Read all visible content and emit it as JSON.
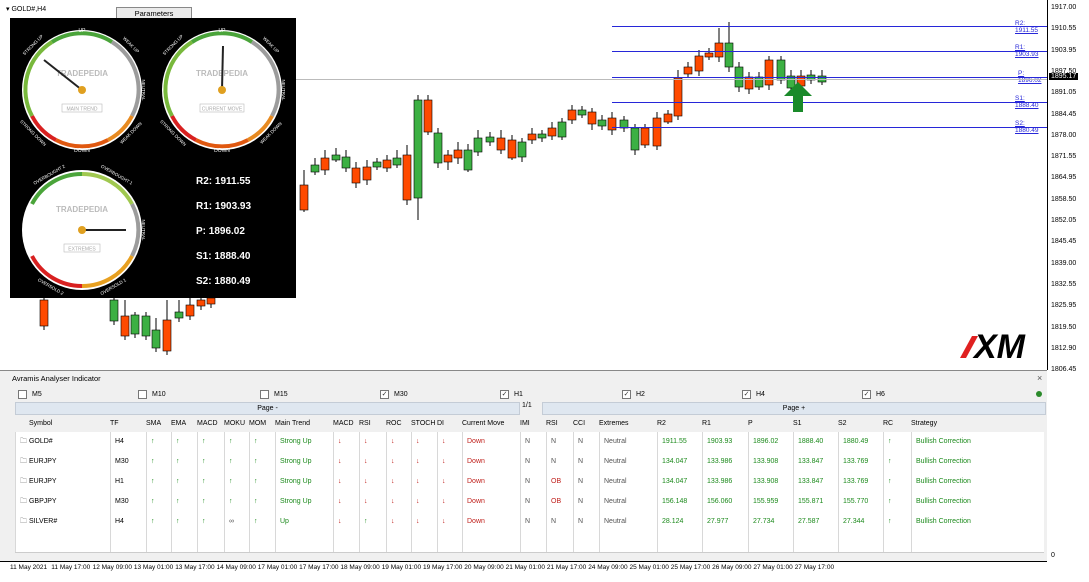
{
  "symbol_label": "GOLD#,H4",
  "params_button": "Parameters",
  "gauges": [
    {
      "brand": "TRADEPEDIA",
      "caption": "MAIN TREND",
      "labels": {
        "up": "UP",
        "strong_up": "STRONG UP",
        "weak_up": "WEAK UP",
        "neutral": "NEUTRAL",
        "strong_down": "STRONG DOWN",
        "weak_down": "WEAK DOWN",
        "down": "DOWN"
      }
    },
    {
      "brand": "TRADEPEDIA",
      "caption": "CURRENT MOVE",
      "labels": {
        "up": "UP",
        "strong_up": "STRONG UP",
        "weak_up": "WEAK UP",
        "neutral": "NEUTRAL",
        "strong_down": "STRONG DOWN",
        "weak_down": "WEAK DOWN",
        "down": "DOWN"
      }
    },
    {
      "brand": "TRADEPEDIA",
      "caption": "EXTREMES",
      "labels": {
        "ob2": "OVERBOUGHT 2",
        "ob1": "OVERBOUGHT 1",
        "neutral": "NEUTRAL",
        "os2": "OVERSOLD 2",
        "os1": "OVERSOLD 1"
      }
    }
  ],
  "pivots_panel": {
    "r2": "R2: 1911.55",
    "r1": "R1: 1903.93",
    "p": "P:   1896.02",
    "s1": "S1: 1888.40",
    "s2": "S2: 1880.49"
  },
  "pivot_lines": {
    "r2": "R2: 1911.55",
    "r1": "R1: 1903.93",
    "p": "P: 1896.02",
    "s1": "S1: 1888.40",
    "s2": "S2: 1880.49"
  },
  "price_axis": [
    "1917.00",
    "1910.55",
    "1903.95",
    "1897.50",
    "1891.05",
    "1884.45",
    "1878.00",
    "1871.55",
    "1864.95",
    "1858.50",
    "1852.05",
    "1845.45",
    "1839.00",
    "1832.55",
    "1825.95",
    "1819.50",
    "1812.90",
    "1806.45"
  ],
  "current_price": "1895.17",
  "logo_text": "XM",
  "panel": {
    "title": "Avramis Analyser Indicator",
    "close": "×",
    "timeframes": [
      {
        "label": "M5",
        "checked": false
      },
      {
        "label": "M10",
        "checked": false
      },
      {
        "label": "M15",
        "checked": false
      },
      {
        "label": "M30",
        "checked": true
      },
      {
        "label": "H1",
        "checked": true
      },
      {
        "label": "H2",
        "checked": true
      },
      {
        "label": "H4",
        "checked": true
      },
      {
        "label": "H6",
        "checked": true
      }
    ],
    "page_prev": "Page -",
    "page_next": "Page +",
    "page_num": "1/1",
    "headers": [
      "Symbol",
      "TF",
      "SMA",
      "EMA",
      "MACD",
      "MOKU",
      "MOM",
      "Main Trend",
      "MACD",
      "RSI",
      "ROC",
      "STOCH",
      "DI",
      "Current Move",
      "IMI",
      "RSI",
      "CCI",
      "Extremes",
      "R2",
      "R1",
      "P",
      "S1",
      "S2",
      "RC",
      "Strategy"
    ],
    "rows": [
      {
        "symbol": "GOLD#",
        "tf": "H4",
        "sma": "↑",
        "ema": "↑",
        "macd": "↑",
        "moku": "↑",
        "mom": "↑",
        "main_trend": "Strong Up",
        "macd2": "↓",
        "rsi": "↓",
        "roc": "↓",
        "stoch": "↓",
        "di": "↓",
        "current_move": "Down",
        "imi": "N",
        "rsi2": "N",
        "cci": "N",
        "extremes": "Neutral",
        "r2": "1911.55",
        "r1": "1903.93",
        "p": "1896.02",
        "s1": "1888.40",
        "s2": "1880.49",
        "rc": "↑",
        "strategy": "Bullish Correction"
      },
      {
        "symbol": "EURJPY",
        "tf": "M30",
        "sma": "↑",
        "ema": "↑",
        "macd": "↑",
        "moku": "↑",
        "mom": "↑",
        "main_trend": "Strong Up",
        "macd2": "↓",
        "rsi": "↓",
        "roc": "↓",
        "stoch": "↓",
        "di": "↓",
        "current_move": "Down",
        "imi": "N",
        "rsi2": "N",
        "cci": "N",
        "extremes": "Neutral",
        "r2": "134.047",
        "r1": "133.986",
        "p": "133.908",
        "s1": "133.847",
        "s2": "133.769",
        "rc": "↑",
        "strategy": "Bullish Correction"
      },
      {
        "symbol": "EURJPY",
        "tf": "H1",
        "sma": "↑",
        "ema": "↑",
        "macd": "↑",
        "moku": "↑",
        "mom": "↑",
        "main_trend": "Strong Up",
        "macd2": "↓",
        "rsi": "↓",
        "roc": "↓",
        "stoch": "↓",
        "di": "↓",
        "current_move": "Down",
        "imi": "N",
        "rsi2": "OB",
        "cci": "N",
        "extremes": "Neutral",
        "r2": "134.047",
        "r1": "133.986",
        "p": "133.908",
        "s1": "133.847",
        "s2": "133.769",
        "rc": "↑",
        "strategy": "Bullish Correction"
      },
      {
        "symbol": "GBPJPY",
        "tf": "M30",
        "sma": "↑",
        "ema": "↑",
        "macd": "↑",
        "moku": "↑",
        "mom": "↑",
        "main_trend": "Strong Up",
        "macd2": "↓",
        "rsi": "↓",
        "roc": "↓",
        "stoch": "↓",
        "di": "↓",
        "current_move": "Down",
        "imi": "N",
        "rsi2": "OB",
        "cci": "N",
        "extremes": "Neutral",
        "r2": "156.148",
        "r1": "156.060",
        "p": "155.959",
        "s1": "155.871",
        "s2": "155.770",
        "rc": "↑",
        "strategy": "Bullish Correction"
      },
      {
        "symbol": "SILVER#",
        "tf": "H4",
        "sma": "↑",
        "ema": "↑",
        "macd": "↑",
        "moku": "∞",
        "mom": "↑",
        "main_trend": "Up",
        "macd2": "↓",
        "rsi": "↑",
        "roc": "↓",
        "stoch": "↓",
        "di": "↓",
        "current_move": "Down",
        "imi": "N",
        "rsi2": "N",
        "cci": "N",
        "extremes": "Neutral",
        "r2": "28.124",
        "r1": "27.977",
        "p": "27.734",
        "s1": "27.587",
        "s2": "27.344",
        "rc": "↑",
        "strategy": "Bullish Correction"
      }
    ],
    "zero_label": "0"
  },
  "time_axis": [
    "11 May 2021",
    "11 May 17:00",
    "12 May 09:00",
    "13 May 01:00",
    "13 May 17:00",
    "14 May 09:00",
    "17 May 01:00",
    "17 May 17:00",
    "18 May 09:00",
    "19 May 01:00",
    "19 May 17:00",
    "20 May 09:00",
    "21 May 01:00",
    "21 May 17:00",
    "24 May 09:00",
    "25 May 01:00",
    "25 May 17:00",
    "26 May 09:00",
    "27 May 01:00",
    "27 May 17:00"
  ],
  "colors": {
    "bull": "#3cb043",
    "bear": "#ff4a00",
    "pivot": "#2727d8",
    "panel_bg": "#000000",
    "up_arrow": "#1c8a1c",
    "down_arrow": "#c0201c"
  }
}
